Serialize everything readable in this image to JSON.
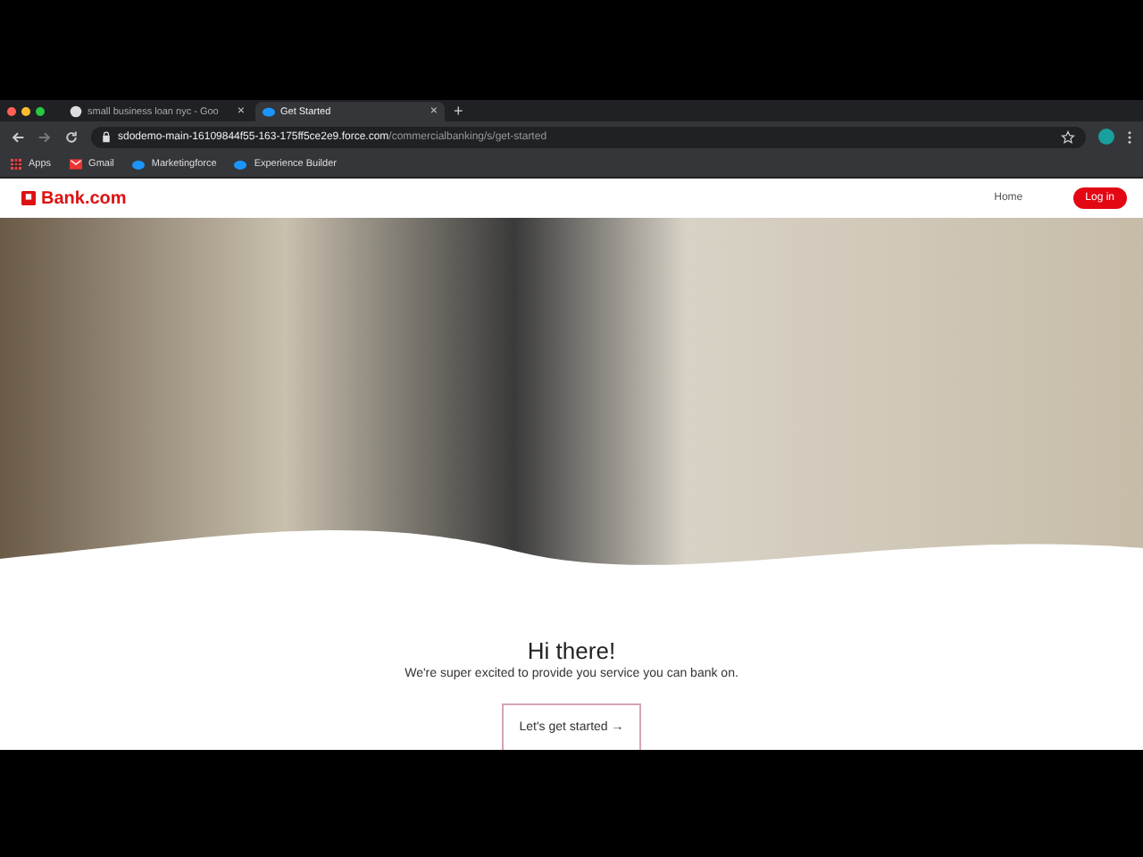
{
  "browser": {
    "tabs": [
      {
        "title": "small business loan nyc - Goo",
        "selected": false,
        "close": "×"
      },
      {
        "title": "Get Started",
        "selected": true,
        "close": "×"
      }
    ],
    "new_tab": "+",
    "address": {
      "host": "sdodemo-main-16109844f55-163-175ff5ce2e9.force.com",
      "path": "/commercialbanking/s/get-started"
    },
    "bookmarks": [
      {
        "label": "Apps",
        "kind": "apps"
      },
      {
        "label": "Gmail",
        "kind": "mail"
      },
      {
        "label": "Marketingforce",
        "kind": "cloud"
      },
      {
        "label": "Experience Builder",
        "kind": "cloud"
      }
    ]
  },
  "site": {
    "logo": "Bank.com",
    "nav": [
      {
        "label": "Home"
      }
    ],
    "login": "Log in"
  },
  "hero": {
    "heading": "Hi there!",
    "subheading": "We're super excited to provide you service you can bank on.",
    "cta": "Let's get started →"
  }
}
